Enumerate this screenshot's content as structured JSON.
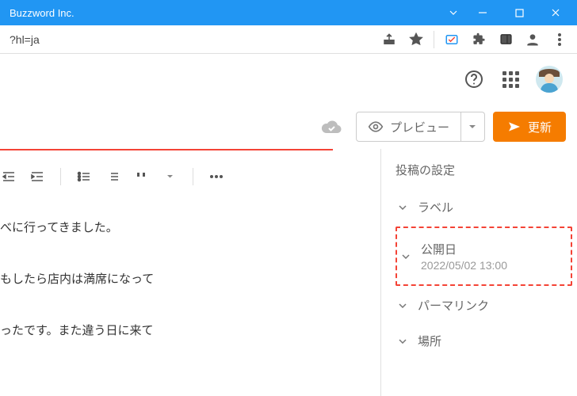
{
  "window": {
    "title": "Buzzword Inc."
  },
  "addressbar": {
    "url": "?hl=ja"
  },
  "actions": {
    "preview_label": "プレビュー",
    "update_label": "更新"
  },
  "editor": {
    "lines": [
      "べに行ってきました。",
      "もしたら店内は満席になって",
      "ったです。また違う日に来て"
    ]
  },
  "sidebar": {
    "title": "投稿の設定",
    "items": {
      "labels": "ラベル",
      "publish_heading": "公開日",
      "publish_value": "2022/05/02 13:00",
      "permalink": "パーマリンク",
      "location": "場所"
    }
  }
}
